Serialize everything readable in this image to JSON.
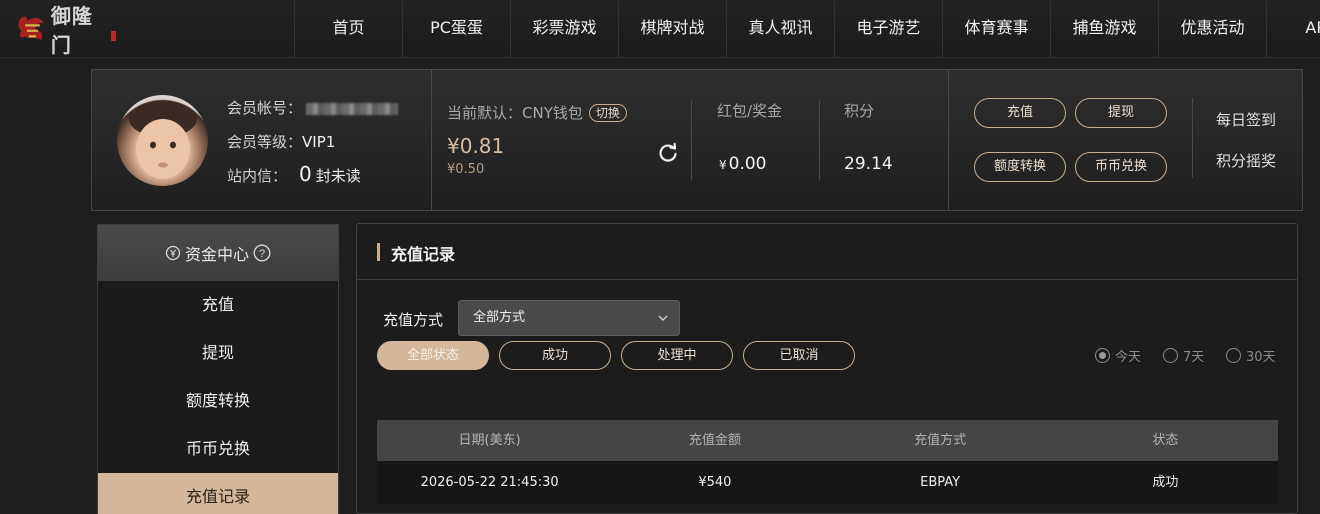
{
  "brand": {
    "name": "御隆门"
  },
  "nav": {
    "items": [
      "首页",
      "PC蛋蛋",
      "彩票游戏",
      "棋牌对战",
      "真人视讯",
      "电子游艺",
      "体育赛事",
      "捕鱼游戏",
      "优惠活动",
      "APP"
    ]
  },
  "member": {
    "account_label": "会员帐号：",
    "level_label": "会员等级：",
    "level_value": "VIP1",
    "inbox_label": "站内信：",
    "inbox_count": "0",
    "inbox_suffix": "封未读",
    "wallet_label": "当前默认：CNY钱包",
    "switch_label": "切换",
    "balance": "¥0.81",
    "balance_sub": "¥0.50",
    "bonus_label": "红包/奖金",
    "bonus_currency": "¥",
    "bonus_value": "0.00",
    "points_label": "积分",
    "points_value": "29.14",
    "actions": {
      "deposit": "充值",
      "withdraw": "提现",
      "transfer": "额度转换",
      "exchange": "币币兑换"
    },
    "checkin": "每日签到",
    "lottery": "积分摇奖"
  },
  "sidebar": {
    "title": "资金中心",
    "items": [
      "充值",
      "提现",
      "额度转换",
      "币币兑换",
      "充值记录"
    ],
    "active_index": 4
  },
  "main": {
    "title": "充值记录",
    "method_label": "充值方式",
    "method_value": "全部方式",
    "filters": [
      "全部状态",
      "成功",
      "处理中",
      "已取消"
    ],
    "active_filter": 0,
    "ranges": [
      "今天",
      "7天",
      "30天"
    ],
    "active_range": 0,
    "table": {
      "headers": [
        "日期(美东)",
        "充值金额",
        "充值方式",
        "状态"
      ],
      "rows": [
        [
          "2026-05-22 21:45:30",
          "¥540",
          "EBPAY",
          "成功"
        ]
      ]
    }
  },
  "colors": {
    "accent": "#d4b79a",
    "accent_border": "#c9ad90",
    "background": "#1e1e1f"
  }
}
